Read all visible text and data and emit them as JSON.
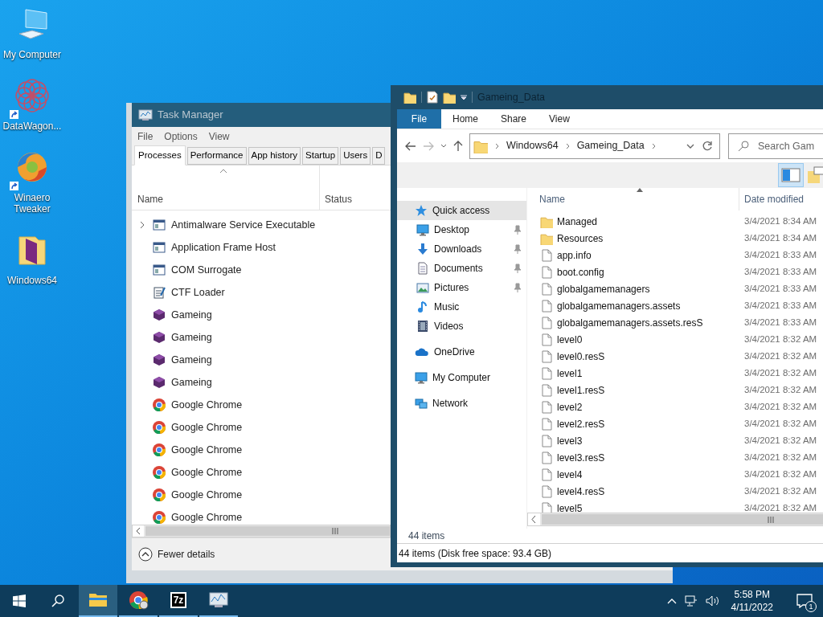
{
  "desktop_icons": [
    {
      "label": "My Computer",
      "kind": "computer",
      "shortcut": false
    },
    {
      "label": "DataWagon...",
      "kind": "mandala",
      "shortcut": true
    },
    {
      "label": "Winaero Tweaker",
      "kind": "swirl",
      "shortcut": true
    },
    {
      "label": "Windows64",
      "kind": "folder",
      "shortcut": false
    }
  ],
  "task_manager": {
    "title": "Task Manager",
    "menu": [
      "File",
      "Options",
      "View"
    ],
    "tabs": [
      {
        "label": "Processes",
        "selected": true
      },
      {
        "label": "Performance",
        "selected": false
      },
      {
        "label": "App history",
        "selected": false
      },
      {
        "label": "Startup",
        "selected": false
      },
      {
        "label": "Users",
        "selected": false
      },
      {
        "label": "D",
        "selected": false
      }
    ],
    "columns": [
      "Name",
      "Status"
    ],
    "processes": [
      {
        "name": "Antimalware Service Executable",
        "kind": "window",
        "expandable": true
      },
      {
        "name": "Application Frame Host",
        "kind": "window",
        "expandable": false
      },
      {
        "name": "COM Surrogate",
        "kind": "window",
        "expandable": false
      },
      {
        "name": "CTF Loader",
        "kind": "pen",
        "expandable": false
      },
      {
        "name": "Gameing",
        "kind": "cube",
        "expandable": false
      },
      {
        "name": "Gameing",
        "kind": "cube",
        "expandable": false
      },
      {
        "name": "Gameing",
        "kind": "cube",
        "expandable": false
      },
      {
        "name": "Gameing",
        "kind": "cube",
        "expandable": false
      },
      {
        "name": "Google Chrome",
        "kind": "chrome",
        "expandable": false
      },
      {
        "name": "Google Chrome",
        "kind": "chrome",
        "expandable": false
      },
      {
        "name": "Google Chrome",
        "kind": "chrome",
        "expandable": false
      },
      {
        "name": "Google Chrome",
        "kind": "chrome",
        "expandable": false
      },
      {
        "name": "Google Chrome",
        "kind": "chrome",
        "expandable": false
      },
      {
        "name": "Google Chrome",
        "kind": "chrome",
        "expandable": false
      }
    ],
    "footer": "Fewer details"
  },
  "explorer": {
    "title": "Gameing_Data",
    "ribbon_tabs": [
      {
        "label": "File",
        "selected": true
      },
      {
        "label": "Home",
        "selected": false
      },
      {
        "label": "Share",
        "selected": false
      },
      {
        "label": "View",
        "selected": false
      }
    ],
    "breadcrumb": [
      "Windows64",
      "Gameing_Data"
    ],
    "search": {
      "placeholder": "Search Gam"
    },
    "nav": [
      {
        "label": "Quick access",
        "kind": "star",
        "pinned": false,
        "selected": true,
        "children": [
          {
            "label": "Desktop",
            "kind": "desktop",
            "pinned": true,
            "selected": false
          },
          {
            "label": "Downloads",
            "kind": "download",
            "pinned": true,
            "selected": false
          },
          {
            "label": "Documents",
            "kind": "document",
            "pinned": true,
            "selected": false
          },
          {
            "label": "Pictures",
            "kind": "pictures",
            "pinned": true,
            "selected": false
          },
          {
            "label": "Music",
            "kind": "music",
            "pinned": false,
            "selected": false
          },
          {
            "label": "Videos",
            "kind": "videos",
            "pinned": false,
            "selected": false
          }
        ]
      },
      {
        "label": "OneDrive",
        "kind": "cloud",
        "pinned": false,
        "selected": false
      },
      {
        "label": "My Computer",
        "kind": "desktop",
        "pinned": false,
        "selected": false
      },
      {
        "label": "Network",
        "kind": "network",
        "pinned": false,
        "selected": false
      }
    ],
    "columns": [
      "Name",
      "Date modified"
    ],
    "files": [
      {
        "name": "Managed",
        "kind": "folder",
        "date": "3/4/2021 8:34 AM"
      },
      {
        "name": "Resources",
        "kind": "folder",
        "date": "3/4/2021 8:34 AM"
      },
      {
        "name": "app.info",
        "kind": "file",
        "date": "3/4/2021 8:33 AM"
      },
      {
        "name": "boot.config",
        "kind": "file",
        "date": "3/4/2021 8:33 AM"
      },
      {
        "name": "globalgamemanagers",
        "kind": "file",
        "date": "3/4/2021 8:33 AM"
      },
      {
        "name": "globalgamemanagers.assets",
        "kind": "file",
        "date": "3/4/2021 8:33 AM"
      },
      {
        "name": "globalgamemanagers.assets.resS",
        "kind": "file",
        "date": "3/4/2021 8:33 AM"
      },
      {
        "name": "level0",
        "kind": "file",
        "date": "3/4/2021 8:32 AM"
      },
      {
        "name": "level0.resS",
        "kind": "file",
        "date": "3/4/2021 8:32 AM"
      },
      {
        "name": "level1",
        "kind": "file",
        "date": "3/4/2021 8:32 AM"
      },
      {
        "name": "level1.resS",
        "kind": "file",
        "date": "3/4/2021 8:32 AM"
      },
      {
        "name": "level2",
        "kind": "file",
        "date": "3/4/2021 8:32 AM"
      },
      {
        "name": "level2.resS",
        "kind": "file",
        "date": "3/4/2021 8:32 AM"
      },
      {
        "name": "level3",
        "kind": "file",
        "date": "3/4/2021 8:32 AM"
      },
      {
        "name": "level3.resS",
        "kind": "file",
        "date": "3/4/2021 8:32 AM"
      },
      {
        "name": "level4",
        "kind": "file",
        "date": "3/4/2021 8:32 AM"
      },
      {
        "name": "level4.resS",
        "kind": "file",
        "date": "3/4/2021 8:32 AM"
      },
      {
        "name": "level5",
        "kind": "file",
        "date": "3/4/2021 8:32 AM"
      }
    ],
    "item_count": "44 items",
    "status": "44 items (Disk free space: 93.4 GB)"
  },
  "taskbar": {
    "apps": [
      {
        "kind": "folder",
        "active": true,
        "open": true
      },
      {
        "kind": "chrome",
        "active": false,
        "open": true
      },
      {
        "kind": "sevenzip",
        "active": false,
        "open": true
      },
      {
        "kind": "taskmgr",
        "active": false,
        "open": true
      }
    ],
    "sevenzip_label": "7z",
    "time": "5:58 PM",
    "date": "4/11/2022",
    "notifications": "1"
  }
}
